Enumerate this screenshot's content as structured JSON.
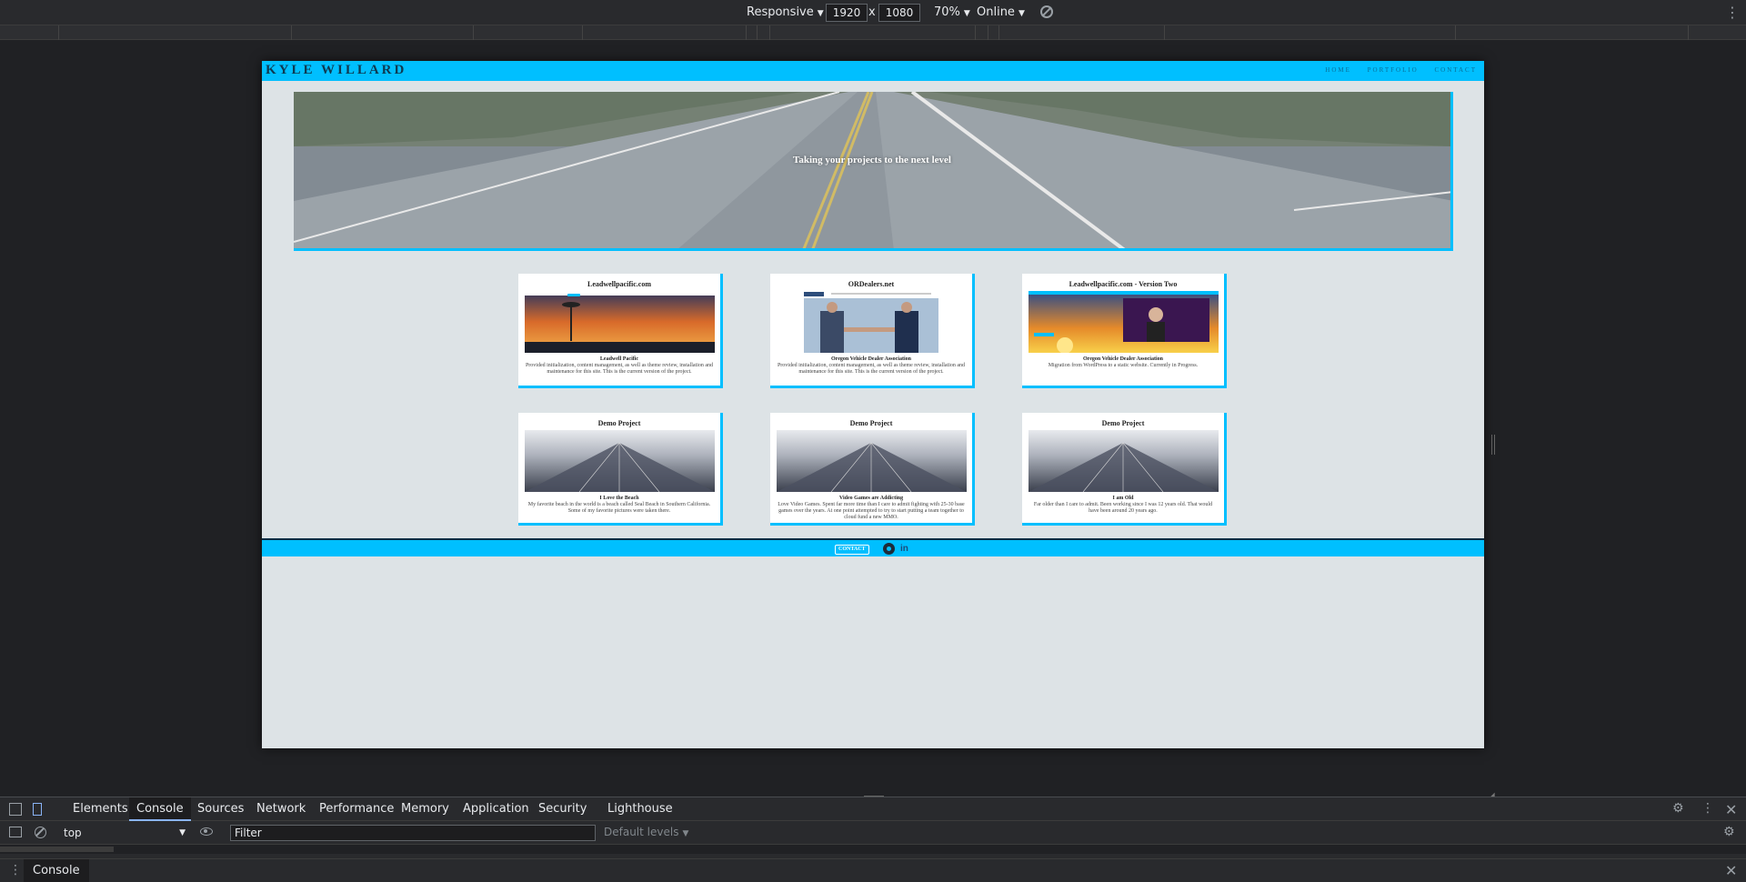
{
  "device_toolbar": {
    "mode": "Responsive",
    "width": "1920",
    "times": "x",
    "height": "1080",
    "zoom": "70%",
    "network": "Online"
  },
  "site": {
    "logo": "KYLE WILLARD",
    "nav": [
      "HOME",
      "PORTFOLIO",
      "CONTACT"
    ],
    "hero_text": "Taking your projects to the next level",
    "cards": [
      {
        "title": "Leadwellpacific.com",
        "subtitle": "Leadwell Pacific",
        "description": "Provided initialization, content management, as well as theme review, installation and maintenance for this site. This is the current version of the project.",
        "image": "space-needle-sunset"
      },
      {
        "title": "ORDealers.net",
        "subtitle": "Oregon Vehicle Dealer Association",
        "description": "Provided initialization, content management, as well as theme review, installation and maintenance for this site. This is the current version of the project.",
        "image": "dealers-handshake"
      },
      {
        "title": "Leadwellpacific.com - Version Two",
        "subtitle": "Oregon Vehicle Dealer Association",
        "description": "Migration from WordPress to a static website. Currently in Progress.",
        "image": "sunset-website"
      },
      {
        "title": "Demo Project",
        "subtitle": "I Love the Beach",
        "description": "My favorite beach in the world is a beach called Seal Beach in Southern California. Some of my favorite pictures were taken there.",
        "image": "building-perspective"
      },
      {
        "title": "Demo Project",
        "subtitle": "Video Games are Addicting",
        "description": "Love Video Games. Spent far more time than I care to admit fighting with 25-30 base games over the years. At one point attempted to try to start putting a team together to cloud fund a new MMO.",
        "image": "building-perspective"
      },
      {
        "title": "Demo Project",
        "subtitle": "I am Old",
        "description": "Far older than I care to admit. Been working since I was 12 years old. That would have been around 20 years ago.",
        "image": "building-perspective"
      }
    ],
    "footer": {
      "contact": "CONTACT",
      "icons": [
        "github-icon",
        "linkedin-icon"
      ]
    }
  },
  "devtools": {
    "tabs": [
      "Elements",
      "Console",
      "Sources",
      "Network",
      "Performance",
      "Memory",
      "Application",
      "Security",
      "Lighthouse"
    ],
    "active_tab": "Console",
    "context": "top",
    "filter_placeholder": "Filter",
    "levels": "Default levels",
    "drawer_tab": "Console"
  },
  "colors": {
    "accent": "#00bfff",
    "page_bg": "#dde3e6",
    "devtools_bg": "#292a2d"
  }
}
